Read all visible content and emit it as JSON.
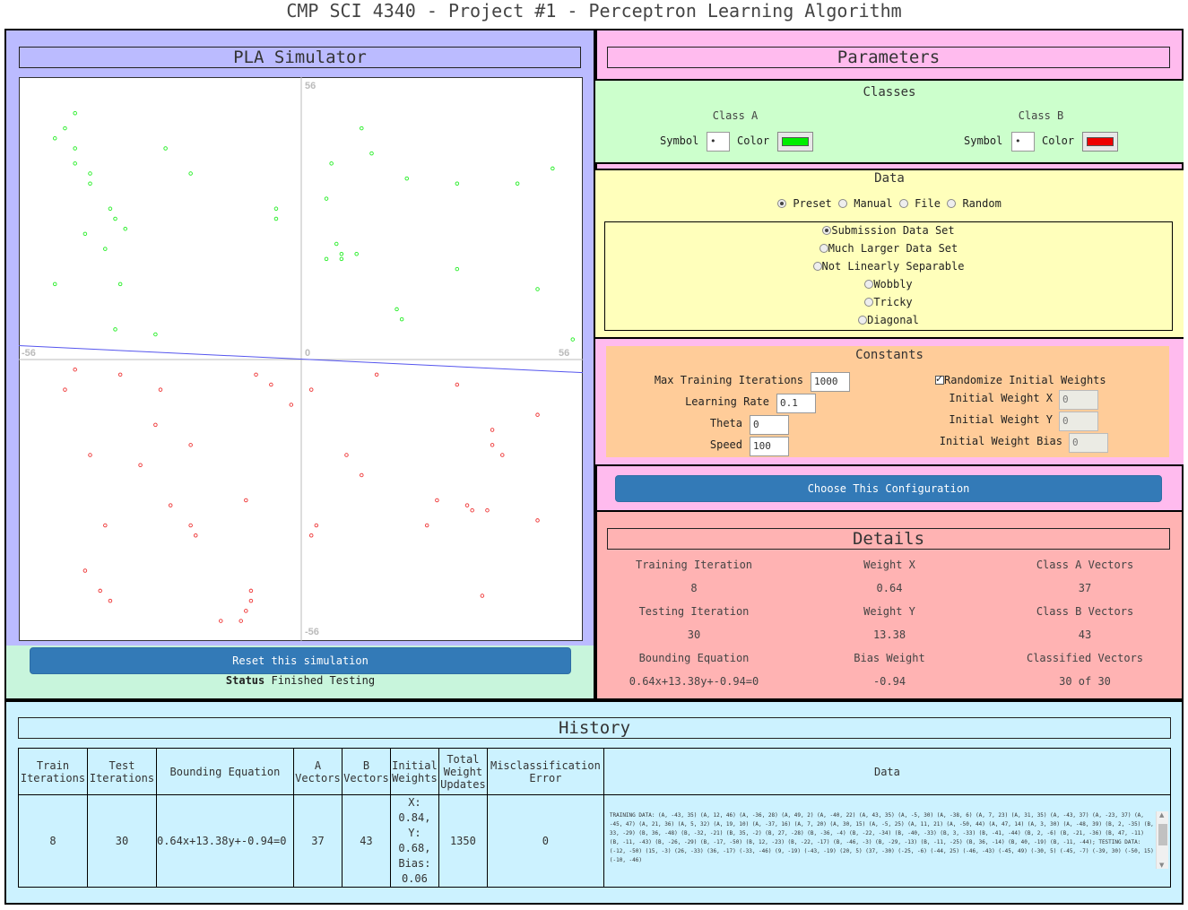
{
  "page_title": "CMP SCI 4340 - Project #1 - Perceptron Learning Algorithm",
  "simulator": {
    "title": "PLA Simulator",
    "axis_labels": {
      "y_max": "56",
      "x_min": "-56",
      "origin": "0",
      "x_max": "56",
      "y_min": "-56"
    },
    "reset_label": "Reset this simulation",
    "status_label": "Status",
    "status_value": "Finished Testing"
  },
  "plot": {
    "range": 56,
    "line": {
      "wx": 0.64,
      "wy": 13.38,
      "bias": -0.94,
      "color": "#5555ee"
    },
    "class_a_color": "#22ee22",
    "class_b_color": "#ee3333",
    "class_a_points": [
      [
        -45,
        49
      ],
      [
        -47,
        46
      ],
      [
        -49,
        44
      ],
      [
        -45,
        42
      ],
      [
        -45,
        39
      ],
      [
        -42,
        37
      ],
      [
        -42,
        35
      ],
      [
        -27,
        42
      ],
      [
        -22,
        37
      ],
      [
        -38,
        30
      ],
      [
        -37,
        28
      ],
      [
        -35,
        26
      ],
      [
        -43,
        25
      ],
      [
        -39,
        22
      ],
      [
        -36,
        15
      ],
      [
        -49,
        15
      ],
      [
        -37,
        6
      ],
      [
        -29,
        5
      ],
      [
        -5,
        30
      ],
      [
        -5,
        28
      ],
      [
        12,
        46
      ],
      [
        14,
        41
      ],
      [
        6,
        39
      ],
      [
        5,
        32
      ],
      [
        21,
        36
      ],
      [
        31,
        35
      ],
      [
        43,
        35
      ],
      [
        50,
        38
      ],
      [
        54,
        4
      ],
      [
        47,
        14
      ],
      [
        7,
        23
      ],
      [
        8,
        21
      ],
      [
        11,
        21
      ],
      [
        5,
        20
      ],
      [
        8,
        20
      ],
      [
        31,
        18
      ],
      [
        19,
        10
      ],
      [
        20,
        8
      ]
    ],
    "class_b_points": [
      [
        -45,
        -2
      ],
      [
        -47,
        -6
      ],
      [
        -36,
        -3
      ],
      [
        -28,
        -6
      ],
      [
        -29,
        -13
      ],
      [
        -42,
        -19
      ],
      [
        -32,
        -21
      ],
      [
        -22,
        -17
      ],
      [
        -26,
        -29
      ],
      [
        -39,
        -33
      ],
      [
        -43,
        -42
      ],
      [
        -40,
        -46
      ],
      [
        -38,
        -48
      ],
      [
        -22,
        -33
      ],
      [
        -21,
        -35
      ],
      [
        -11,
        -28
      ],
      [
        -10,
        -46
      ],
      [
        -10,
        -48
      ],
      [
        -11,
        -50
      ],
      [
        -12,
        -52
      ],
      [
        -16,
        -52
      ],
      [
        -9,
        -3
      ],
      [
        -6,
        -5
      ],
      [
        -2,
        -9
      ],
      [
        2,
        -6
      ],
      [
        15,
        -3
      ],
      [
        31,
        -5
      ],
      [
        38,
        -14
      ],
      [
        38,
        -17
      ],
      [
        40,
        -19
      ],
      [
        47,
        -11
      ],
      [
        9,
        -19
      ],
      [
        12,
        -23
      ],
      [
        27,
        -28
      ],
      [
        25,
        -33
      ],
      [
        33,
        -29
      ],
      [
        34,
        -30
      ],
      [
        37,
        -30
      ],
      [
        47,
        -32
      ],
      [
        3,
        -33
      ],
      [
        2,
        -35
      ],
      [
        36,
        -47
      ]
    ]
  },
  "parameters": {
    "title": "Parameters",
    "classes": {
      "title": "Classes",
      "a": {
        "name": "Class A",
        "symbol_label": "Symbol",
        "symbol": "•",
        "color_label": "Color",
        "color": "#00ee00"
      },
      "b": {
        "name": "Class B",
        "symbol_label": "Symbol",
        "symbol": "•",
        "color_label": "Color",
        "color": "#ee0000"
      }
    },
    "data": {
      "title": "Data",
      "sources": [
        "Preset",
        "Manual",
        "File",
        "Random"
      ],
      "selected_source": "Preset",
      "presets": [
        "Submission Data Set",
        "Much Larger Data Set",
        "Not Linearly Separable",
        "Wobbly",
        "Tricky",
        "Diagonal"
      ],
      "selected_preset": "Submission Data Set"
    },
    "constants": {
      "title": "Constants",
      "max_iter_label": "Max Training Iterations",
      "max_iter": "1000",
      "lr_label": "Learning Rate",
      "lr": "0.1",
      "theta_label": "Theta",
      "theta": "0",
      "speed_label": "Speed",
      "speed": "100",
      "randomize_label": "Randomize Initial Weights",
      "randomize": true,
      "wx_label": "Initial Weight X",
      "wx": "0",
      "wy_label": "Initial Weight Y",
      "wy": "0",
      "wb_label": "Initial Weight Bias",
      "wb": "0"
    },
    "choose_label": "Choose This Configuration"
  },
  "details": {
    "title": "Details",
    "training_iteration_label": "Training Iteration",
    "training_iteration": "8",
    "weight_x_label": "Weight X",
    "weight_x": "0.64",
    "class_a_vectors_label": "Class A Vectors",
    "class_a_vectors": "37",
    "testing_iteration_label": "Testing Iteration",
    "testing_iteration": "30",
    "weight_y_label": "Weight Y",
    "weight_y": "13.38",
    "class_b_vectors_label": "Class B Vectors",
    "class_b_vectors": "43",
    "bounding_equation_label": "Bounding Equation",
    "bounding_equation": "0.64x+13.38y+-0.94=0",
    "bias_weight_label": "Bias Weight",
    "bias_weight": "-0.94",
    "classified_vectors_label": "Classified Vectors",
    "classified_vectors": "30 of 30"
  },
  "history": {
    "title": "History",
    "headers": {
      "train": "Train Iterations",
      "test": "Test Iterations",
      "equation": "Bounding Equation",
      "a": "A Vectors",
      "b": "B Vectors",
      "init": "Initial Weights",
      "updates": "Total Weight Updates",
      "error": "Misclassification Error",
      "data": "Data"
    },
    "row": {
      "train": "8",
      "test": "30",
      "equation": "0.64x+13.38y+-0.94=0",
      "a": "37",
      "b": "43",
      "init": "X: 0.84, Y: 0.68, Bias: 0.06",
      "updates": "1350",
      "error": "0",
      "data": "TRAINING DATA: (A, -43, 35) (A, 12, 46) (A, -36, 28) (A, 49, 2) (A, -40, 22) (A, 43, 35) (A, -5, 30) (A, -38, 6) (A, 7, 23) (A, 31, 35) (A, -43, 37) (A, -23, 37) (A, -45, 47) (A, 21, 36) (A, 5, 32) (A, 19, 10) (A, -37, 16) (A, 7, 20) (A, 30, 15) (A, -5, 25) (A, 11, 21) (A, -50, 44) (A, 47, 14) (A, 3, 30) (A, -48, 39) (B, 2, -35) (B, 33, -29) (B, 36, -48) (B, -32, -21) (B, 35, -2) (B, 27, -28) (B, -36, -4) (B, -22, -34) (B, -40, -33) (B, 3, -33) (B, -41, -44) (B, 2, -6) (B, -21, -36) (B, 47, -11) (B, -11, -43) (B, -26, -29) (B, -17, -50) (B, 12, -23) (B, -22, -17) (B, -46, -3) (B, -29, -13) (B, -11, -25) (B, 36, -14) (B, 40, -19) (B, -11, -44); TESTING DATA: (-12, -50) (15, -3) (26, -33) (36, -17) (-33, -46) (9, -19) (-43, -19) (20, 5) (37, -30) (-25, -6) (-44, 25) (-46, -43) (-45, 49) (-30, 5) (-45, -7) (-39, 30) (-50, 15) (-10, -46)"
    }
  }
}
